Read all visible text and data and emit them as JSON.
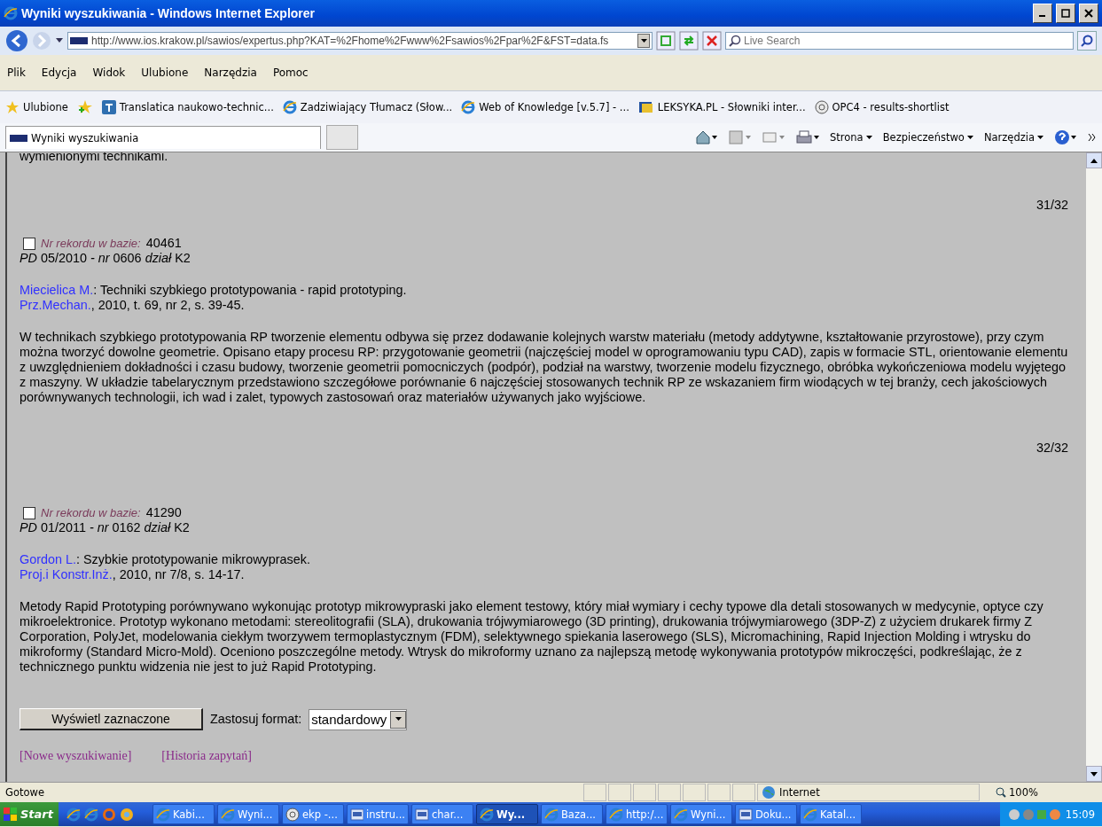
{
  "window": {
    "title": "Wyniki wyszukiwania - Windows Internet Explorer"
  },
  "address": {
    "url": "http://www.ios.krakow.pl/sawios/expertus.php?KAT=%2Fhome%2Fwww%2Fsawios%2Fpar%2F&FST=data.fs",
    "search_placeholder": "Live Search"
  },
  "menu": [
    "Plik",
    "Edycja",
    "Widok",
    "Ulubione",
    "Narzędzia",
    "Pomoc"
  ],
  "favorites": {
    "label": "Ulubione",
    "items": [
      {
        "label": "Translatica naukowo-technic...",
        "kind": "t"
      },
      {
        "label": "Zadziwiający Tłumacz (Słow...",
        "kind": "ie"
      },
      {
        "label": "Web of Knowledge [v.5.7] - ...",
        "kind": "ie"
      },
      {
        "label": "LEKSYKA.PL - Słowniki inter...",
        "kind": "book"
      },
      {
        "label": "OPC4 - results-shortlist",
        "kind": "globe"
      }
    ]
  },
  "tab": {
    "label": "Wyniki wyszukiwania"
  },
  "commands": [
    "Strona",
    "Bezpieczeństwo",
    "Narzędzia"
  ],
  "content": {
    "cut_text": "wymienionymi technikami.",
    "records": [
      {
        "counter": "31/32",
        "checked": false,
        "record_label": "Nr rekordu w bazie:",
        "record_number": "40461",
        "pd_line": "*PD* 05/2010 *- nr* 0606 *dział* K2",
        "author": "Miecielica M.",
        "title": ": Techniki szybkiego prototypowania - rapid prototyping.",
        "journal": "Prz.Mechan.",
        "source": ", 2010, t. 69, nr 2, s. 39-45.",
        "abstract": "W technikach szybkiego prototypowania RP tworzenie elementu odbywa się przez dodawanie kolejnych warstw materiału (metody addytywne, kształtowanie przyrostowe), przy czym można tworzyć dowolne geometrie. Opisano etapy procesu RP: przygotowanie geometrii (najczęściej model w oprogramowaniu typu CAD), zapis w formacie STL, orientowanie elementu z uwzględnieniem dokładności i czasu budowy, tworzenie geometrii pomocniczych (podpór), podział na warstwy, tworzenie modelu fizycznego, obróbka wykończeniowa modelu wyjętego z maszyny. W układzie tabelarycznym przedstawiono szczegółowe porównanie 6 najczęściej stosowanych technik RP ze wskazaniem firm wiodących w tej branży, cech jakościowych porównywanych technologii, ich wad i zalet, typowych zastosowań oraz materiałów używanych jako wyjściowe."
      },
      {
        "counter": "32/32",
        "checked": false,
        "record_label": "Nr rekordu w bazie:",
        "record_number": "41290",
        "pd_line": "*PD* 01/2011 *- nr* 0162 *dział* K2",
        "author": "Gordon L.",
        "title": ": Szybkie prototypowanie mikrowyprasek.",
        "journal": "Proj.i Konstr.Inż.",
        "source": ", 2010, nr 7/8, s. 14-17.",
        "abstract": "Metody Rapid Prototyping porównywano wykonując prototyp mikrowypraski jako element testowy, który miał wymiary i cechy typowe dla detali stosowanych w medycynie, optyce czy mikroelektronice. Prototyp wykonano metodami: stereolitografii (SLA), drukowania trójwymiarowego (3D printing), drukowania trójwymiarowego (3DP-Z) z użyciem drukarek firmy Z Corporation, PolyJet, modelowania ciekłym tworzywem termoplastycznym (FDM), selektywnego spiekania laserowego (SLS), Micromachining, Rapid Injection Molding i wtrysku do mikroformy (Standard Micro-Mold). Oceniono poszczególne metody. Wtrysk do mikroformy uznano za najlepszą metodę wykonywania prototypów mikroczęści, podkreślając, że z technicznego punktu widzenia nie jest to już Rapid Prototyping."
      }
    ],
    "show_button": "Wyświetl zaznaczone",
    "format_label": "Zastosuj format:",
    "format_value": "standardowy",
    "links": [
      "[Nowe wyszukiwanie]",
      "[Historia zapytań]"
    ]
  },
  "status_bar": {
    "text": "Gotowe",
    "zone": "Internet",
    "zoom": "100%"
  },
  "taskbar": {
    "start": "Start",
    "clock": "15:09",
    "tasks": [
      {
        "label": "Kabi...",
        "kind": "ie",
        "selected": false
      },
      {
        "label": "Wyni...",
        "kind": "ie",
        "selected": false
      },
      {
        "label": "ekp -...",
        "kind": "globe",
        "selected": false
      },
      {
        "label": "instru...",
        "kind": "doc",
        "selected": false
      },
      {
        "label": "char...",
        "kind": "doc",
        "selected": false
      },
      {
        "label": "Wy...",
        "kind": "ie",
        "selected": true
      },
      {
        "label": "Baza...",
        "kind": "ie",
        "selected": false
      },
      {
        "label": "http:/...",
        "kind": "ie",
        "selected": false
      },
      {
        "label": "Wyni...",
        "kind": "ie",
        "selected": false
      },
      {
        "label": "Doku...",
        "kind": "doc",
        "selected": false
      },
      {
        "label": "Katal...",
        "kind": "ie",
        "selected": false
      }
    ]
  }
}
